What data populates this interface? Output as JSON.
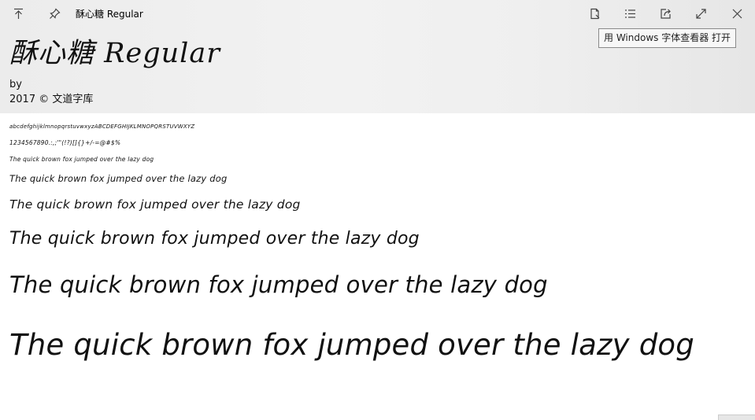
{
  "titlebar": {
    "title": "酥心糖 Regular",
    "left_icons": [
      "arrow-up-icon",
      "pin-icon"
    ],
    "right_icons": [
      "print-icon",
      "list-icon",
      "share-icon",
      "expand-icon",
      "close-icon"
    ]
  },
  "tooltip": "用 Windows 字体查看器 打开",
  "font": {
    "name": "酥心糖 Regular",
    "by": "by",
    "copyright": "2017 © 文道字库"
  },
  "samples": {
    "alphabet": "abcdefghijklmnopqrstuvwxyzABCDEFGHIJKLMNOPQRSTUVWXYZ",
    "digits": "1234567890.:,;'\"(!?)[]{}+/-=@#$%",
    "pangram": "The quick brown fox jumped over the lazy dog"
  }
}
